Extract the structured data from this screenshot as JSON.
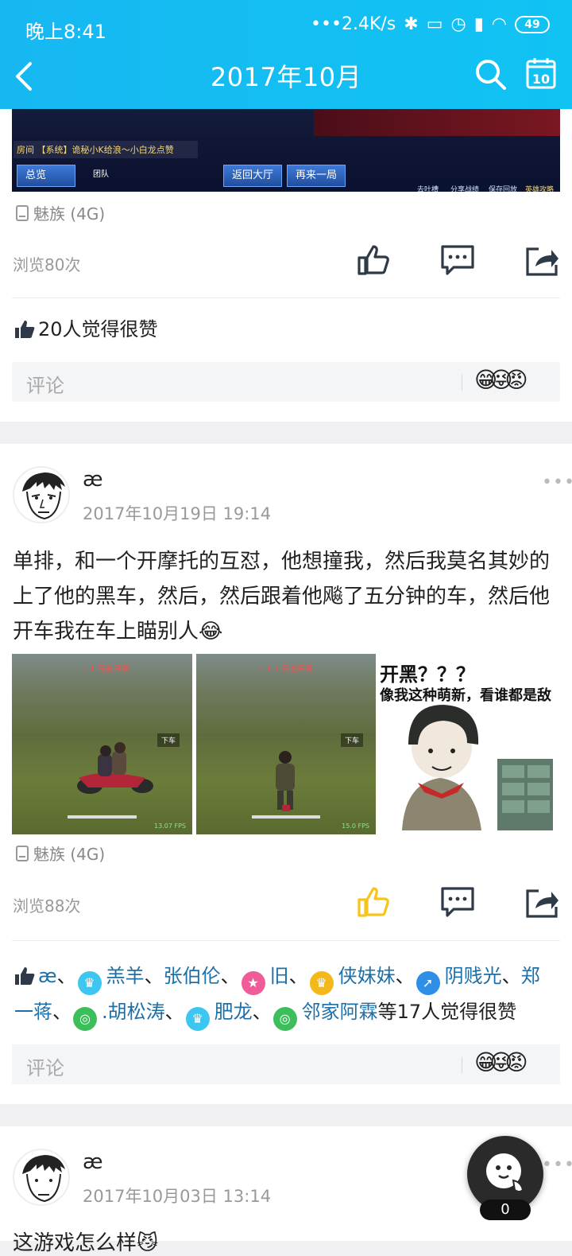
{
  "status_bar": {
    "time": "晚上8:41",
    "speed": "•••2.4K/s",
    "battery": "49"
  },
  "header": {
    "title": "2017年10月"
  },
  "post1": {
    "game_strip": {
      "message": "房间 【系统】诡秘小K给浪～小白龙点赞",
      "btn_overview": "总览",
      "btn_lobby": "返回大厅",
      "btn_again": "再来一局",
      "team": "团队",
      "mini_labels": [
        "去吐槽",
        "分享战绩",
        "保存回放",
        "英雄攻略"
      ]
    },
    "device": "魅族 (4G)",
    "views": "浏览80次",
    "likes": "20人觉得很赞",
    "comment_placeholder": "评论"
  },
  "post2": {
    "username": "æ",
    "time": "2017年10月19日 19:14",
    "text": "单排，和一个开摩托的互怼，他想撞我，然后我莫名其妙的上了他的黑车，然后，然后跟着他飚了五分钟的车，然后他开车我在车上瞄别人😂",
    "images": [
      {
        "hud": "1  1  1  毒圈来袭",
        "tag": "下车",
        "fps": "13.07 FPS"
      },
      {
        "hud": "1  1  1  毒圈来袭",
        "tag": "下车",
        "fps": "15.0 FPS"
      },
      {
        "line1": "开黑？？？",
        "line2": "像我这种萌新，看谁都是敌"
      }
    ],
    "device": "魅族 (4G)",
    "views": "浏览88次",
    "likers": [
      {
        "name": "æ",
        "badge": ""
      },
      {
        "name": "羔羊",
        "badge": "crown-blue"
      },
      {
        "name": "张伯伦",
        "badge": ""
      },
      {
        "name": "旧",
        "badge": "star-pink"
      },
      {
        "name": "侠妹妹",
        "badge": "crown-gold"
      },
      {
        "name": "阴贱光",
        "badge": "arrow-blue"
      },
      {
        "name": "郑一蒋",
        "badge": ""
      },
      {
        "name": ".胡松涛",
        "badge": "swirl-green"
      },
      {
        "name": "肥龙",
        "badge": "crown-blue"
      },
      {
        "name": "邻家阿霖",
        "badge": "swirl-green"
      }
    ],
    "likes_suffix": "等17人觉得很赞",
    "comment_placeholder": "评论"
  },
  "post3": {
    "username": "æ",
    "time": "2017年10月03日 13:14",
    "text_start": "这游戏怎么样😼"
  },
  "float": {
    "count": "0"
  },
  "colors": {
    "header": "#14bdf3",
    "like_active": "#f5c51b",
    "icon_dark": "#2f3a48"
  }
}
